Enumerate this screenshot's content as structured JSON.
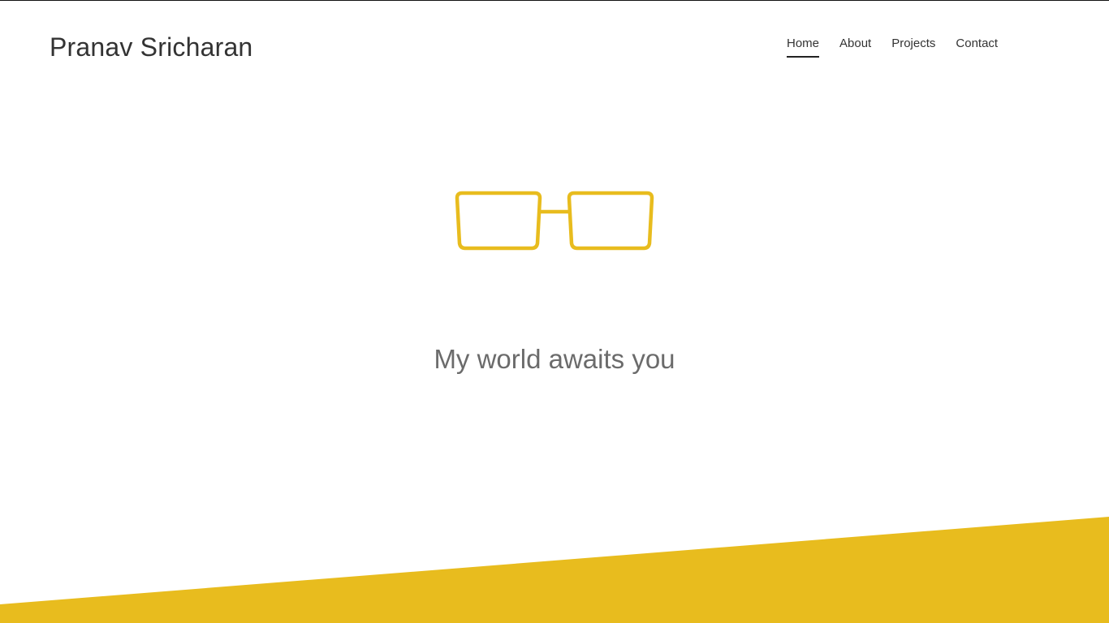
{
  "header": {
    "brand": "Pranav Sricharan"
  },
  "nav": {
    "items": [
      {
        "label": "Home",
        "active": true
      },
      {
        "label": "About",
        "active": false
      },
      {
        "label": "Projects",
        "active": false
      },
      {
        "label": "Contact",
        "active": false
      }
    ]
  },
  "hero": {
    "icon": "glasses-icon",
    "tagline": "My world awaits you"
  },
  "colors": {
    "accent": "#E8BC1E",
    "text": "#333333",
    "tagline": "#6B6B6B",
    "background": "#FFFFFF"
  }
}
